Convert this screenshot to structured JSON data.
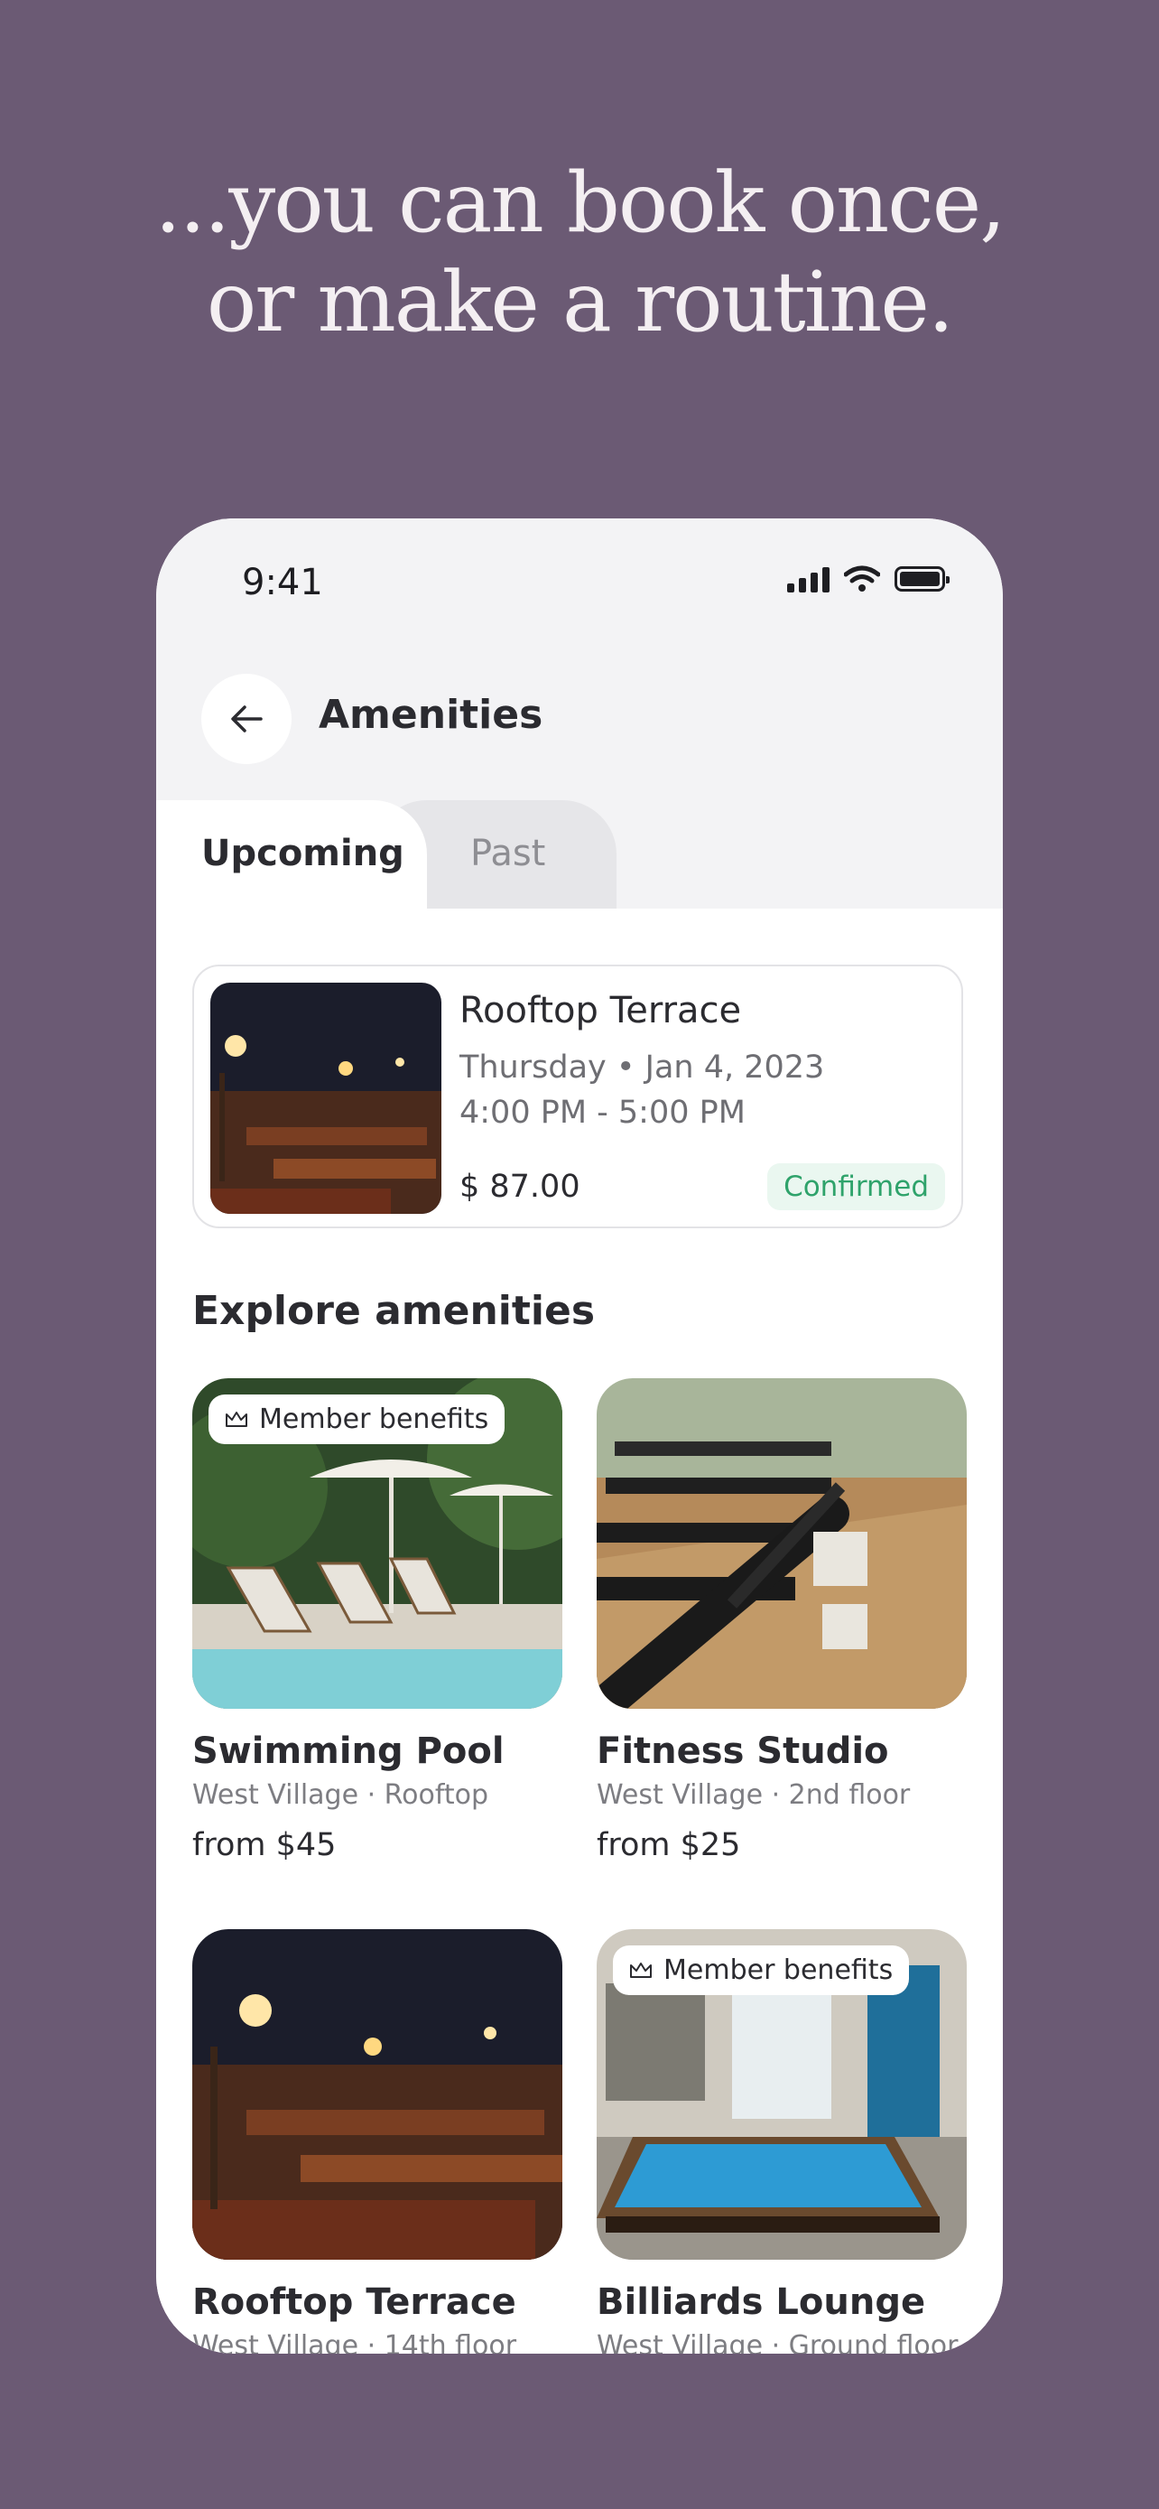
{
  "headline": {
    "line1": "...you can book once,",
    "line2": "or make a routine."
  },
  "status_bar": {
    "time": "9:41",
    "icons": [
      "signal-icon",
      "wifi-icon",
      "battery-icon"
    ]
  },
  "header": {
    "title": "Amenities",
    "back_icon": "arrow-left-icon"
  },
  "tabs": {
    "upcoming": "Upcoming",
    "past": "Past",
    "selected": "Upcoming"
  },
  "booking": {
    "name": "Rooftop Terrace",
    "date": "Thursday • Jan 4, 2023",
    "time": "4:00 PM - 5:00 PM",
    "price": "$ 87.00",
    "status": "Confirmed"
  },
  "explore": {
    "title": "Explore amenities",
    "items": [
      {
        "name": "Swimming Pool",
        "location": "West Village · Rooftop",
        "price": "from $45",
        "badge": "Member benefits"
      },
      {
        "name": "Fitness Studio",
        "location": "West Village · 2nd floor",
        "price": "from $25",
        "badge": ""
      },
      {
        "name": "Rooftop Terrace",
        "location": "West Village · 14th floor",
        "price": "",
        "badge": ""
      },
      {
        "name": "Billiards Lounge",
        "location": "West Village · Ground floor",
        "price": "",
        "badge": "Member benefits"
      }
    ]
  },
  "colors": {
    "background": "#6b5a74",
    "confirmed": "#2fa36b",
    "card_border": "#e3e3e6"
  }
}
